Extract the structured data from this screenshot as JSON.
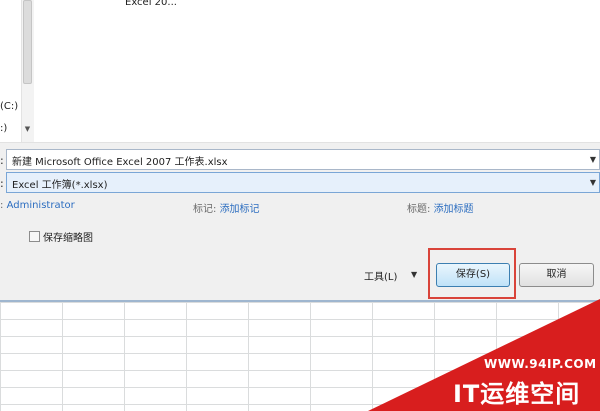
{
  "browser": {
    "partial_file_label": "Excel 20...",
    "drive_label": "(C:)",
    "drive_label_2": ":)"
  },
  "form": {
    "filename_label": ":",
    "filename_value": "新建 Microsoft Office Excel 2007 工作表.xlsx",
    "filetype_label": ":",
    "filetype_value": "Excel 工作簿(*.xlsx)",
    "author_colon": ":",
    "author_value": "Administrator",
    "tags_label": "标记:",
    "tags_link": "添加标记",
    "title_label": "标题:",
    "title_link": "添加标题",
    "thumbnail_label": "保存缩略图",
    "thumbnail_checked": false
  },
  "actions": {
    "tools_label": "工具(L)",
    "save_label": "保存(S)",
    "cancel_label": "取消"
  },
  "watermark": {
    "url": "WWW.94IP.COM",
    "brand": "IT运维空间"
  },
  "colors": {
    "highlight": "#d9443a",
    "link": "#2d6ec0",
    "watermark": "#d81e1e"
  }
}
